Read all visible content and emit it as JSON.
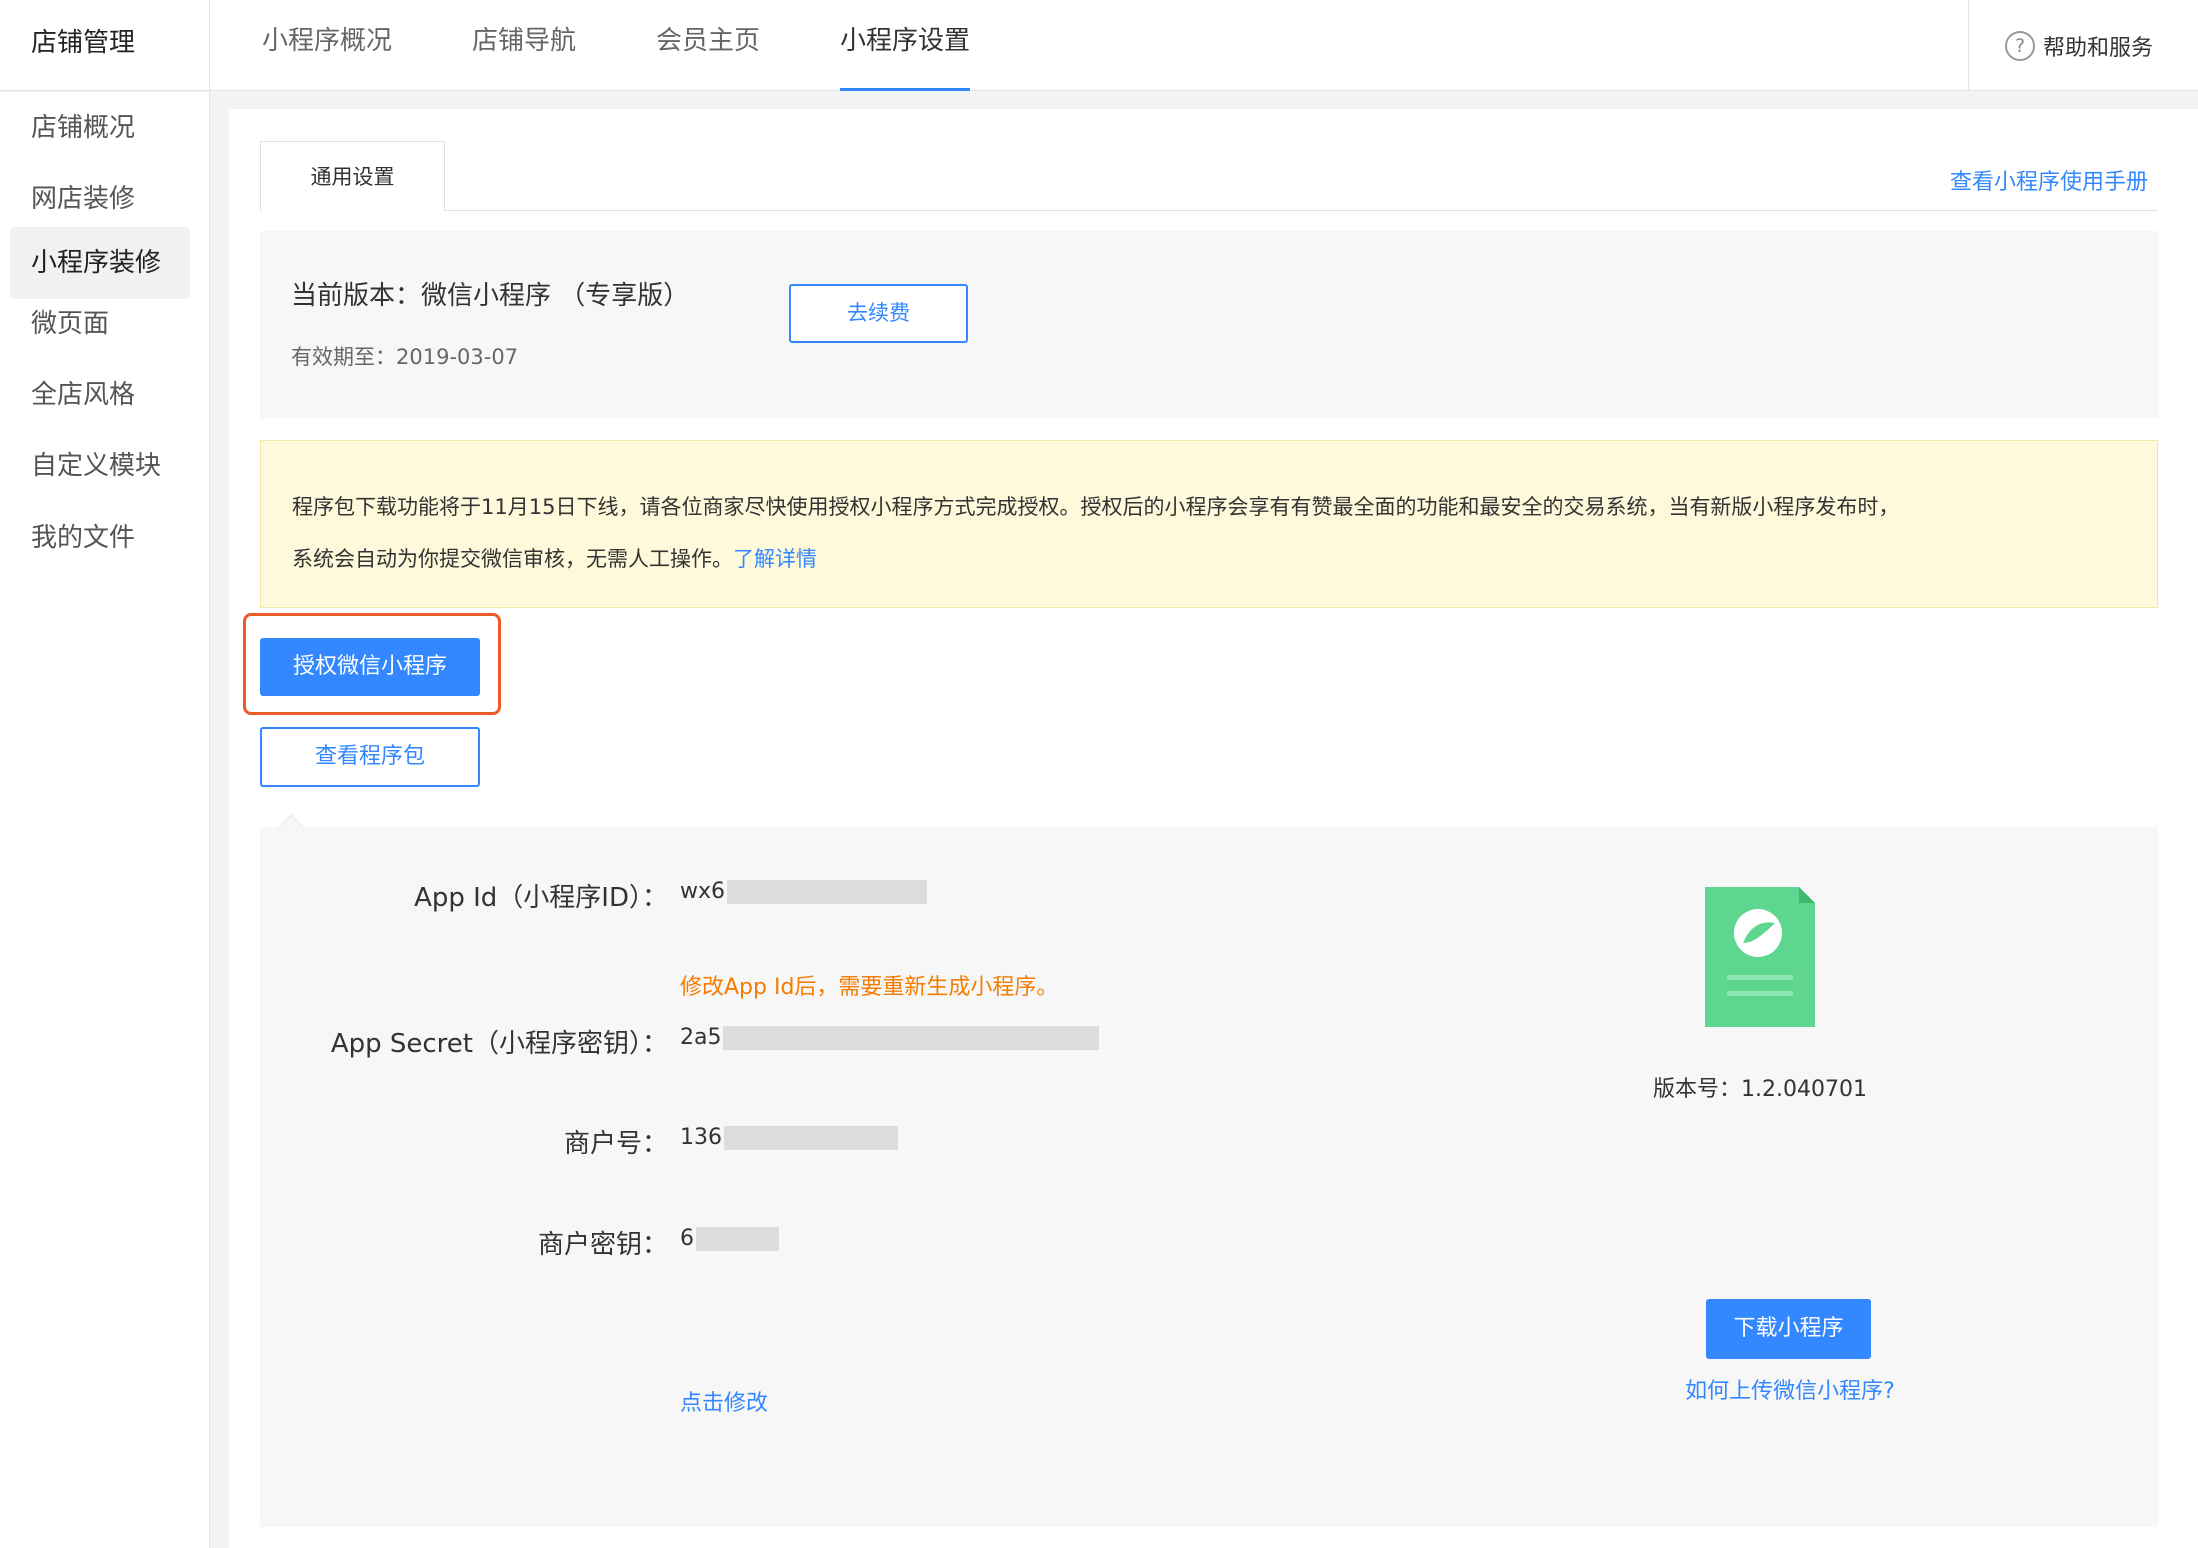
{
  "brand": "店铺管理",
  "top_tabs": [
    {
      "label": "小程序概况"
    },
    {
      "label": "店铺导航"
    },
    {
      "label": "会员主页"
    },
    {
      "label": "小程序设置",
      "active": true
    }
  ],
  "help": {
    "icon": "question-circle-icon",
    "glyph": "?",
    "label": "帮助和服务"
  },
  "sidebar": {
    "items": [
      {
        "label": "店铺概况"
      },
      {
        "label": "网店装修"
      },
      {
        "label": "小程序装修",
        "active": true
      },
      {
        "label": "微页面"
      },
      {
        "label": "全店风格"
      },
      {
        "label": "自定义模块"
      },
      {
        "label": "我的文件"
      }
    ]
  },
  "content": {
    "tab_general": "通用设置",
    "manual_link": "查看小程序使用手册",
    "version_title": "当前版本：微信小程序 （专享版）",
    "version_expire": "有效期至：2019-03-07",
    "renew_button": "去续费",
    "notice_line1": "程序包下载功能将于11月15日下线，请各位商家尽快使用授权小程序方式完成授权。授权后的小程序会享有有赞最全面的功能和最安全的交易系统，当有新版小程序发布时，",
    "notice_line2": "系统会自动为你提交微信审核，无需人工操作。",
    "notice_link": "了解详情",
    "auth_button": "授权微信小程序",
    "package_button": "查看程序包"
  },
  "details": {
    "app_id_label": "App Id（小程序ID）：",
    "app_id_value": "wx6",
    "app_id_warning": "修改App Id后，需要重新生成小程序。",
    "app_secret_label": "App Secret（小程序密钥）：",
    "app_secret_value": "2a5",
    "merchant_no_label": "商户号：",
    "merchant_no_value": "136",
    "merchant_key_label": "商户密钥：",
    "merchant_key_value": "6",
    "edit_link": "点击修改",
    "version_no": "版本号：1.2.040701",
    "download_button": "下载小程序",
    "upload_link": "如何上传微信小程序?"
  },
  "colors": {
    "accent": "#3388ff",
    "warning": "#f57c00",
    "highlight": "#f05a28",
    "doc_green": "#5ed68f"
  }
}
